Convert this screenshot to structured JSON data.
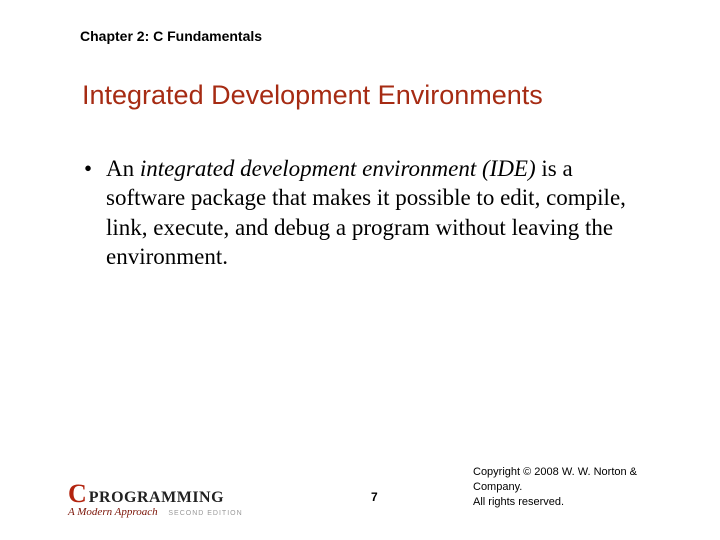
{
  "chapter": "Chapter 2: C Fundamentals",
  "title": "Integrated Development Environments",
  "bullet": {
    "lead": "An ",
    "emphasis": "integrated development environment (IDE)",
    "rest": " is a software package that makes it possible to edit, compile, link, execute, and debug a program without leaving the environment."
  },
  "logo": {
    "c": "C",
    "word": "PROGRAMMING",
    "subtitle": "A Modern Approach",
    "edition": "SECOND EDITION"
  },
  "page_number": "7",
  "copyright_line1": "Copyright © 2008 W. W. Norton & Company.",
  "copyright_line2": "All rights reserved."
}
